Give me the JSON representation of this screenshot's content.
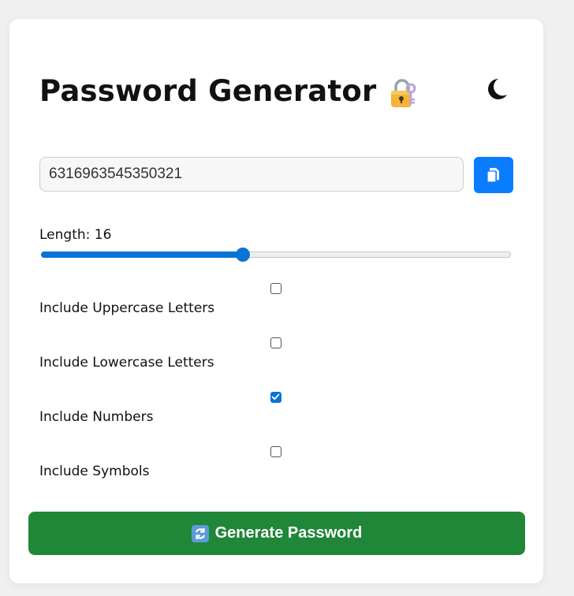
{
  "app": {
    "title": "Password Generator",
    "title_icon": "locked-with-key-icon",
    "theme_toggle_icon": "moon-icon"
  },
  "password": {
    "value": "6316963545350321",
    "copy_icon": "copy-icon"
  },
  "length": {
    "label": "Length: 16",
    "value": 16,
    "slider_fraction": 0.43
  },
  "options": [
    {
      "label": "Include Uppercase Letters",
      "checked": false
    },
    {
      "label": "Include Lowercase Letters",
      "checked": false
    },
    {
      "label": "Include Numbers",
      "checked": true
    },
    {
      "label": "Include Symbols",
      "checked": false
    }
  ],
  "generate": {
    "label": "Generate Password",
    "icon": "refresh-icon"
  },
  "colors": {
    "accent_blue": "#0a7dff",
    "slider_blue": "#0a73d6",
    "generate_green": "#208638",
    "background": "#f0f0f0",
    "card": "#ffffff"
  }
}
